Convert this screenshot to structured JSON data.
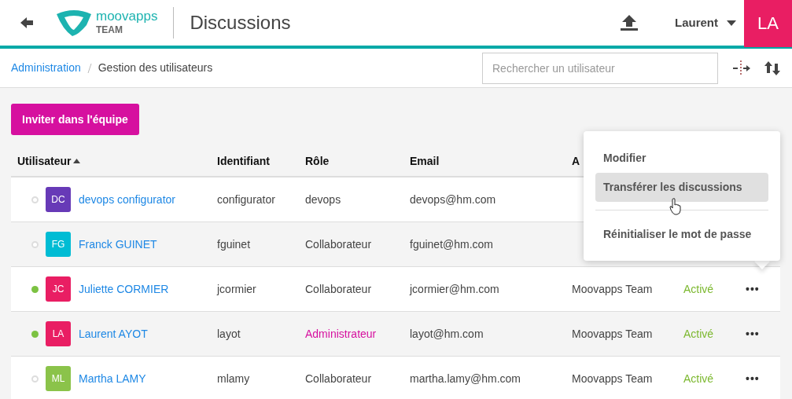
{
  "header": {
    "logo_name": "moovapps",
    "logo_sub": "TEAM",
    "title": "Discussions",
    "user": "Laurent",
    "avatar": "LA"
  },
  "breadcrumb": [
    {
      "label": "Administration",
      "selected": false
    },
    {
      "label": "Gestion des utilisateurs",
      "selected": true
    }
  ],
  "search": {
    "placeholder": "Rechercher un utilisateur"
  },
  "invite_button": "Inviter dans l'équipe",
  "table": {
    "columns": [
      {
        "label": "Utilisateur",
        "sorted": true
      },
      {
        "label": "Identifiant",
        "sorted": false
      },
      {
        "label": "Rôle",
        "sorted": false
      },
      {
        "label": "Email",
        "sorted": false
      },
      {
        "label": "A",
        "sorted": false
      }
    ],
    "rows": [
      {
        "online": false,
        "initials": "DC",
        "color": "#673ab7",
        "name": "devops configurator",
        "login": "configurator",
        "role": "devops",
        "admin": false,
        "email": "devops@hm.com"
      },
      {
        "online": false,
        "initials": "FG",
        "color": "#00bcd4",
        "name": "Franck GUINET",
        "login": "fguinet",
        "role": "Collaborateur",
        "admin": false,
        "email": "fguinet@hm.com"
      },
      {
        "online": true,
        "initials": "JC",
        "color": "#e91e63",
        "name": "Juliette CORMIER",
        "login": "jcormier",
        "role": "Collaborateur",
        "admin": false,
        "email": "jcormier@hm.com",
        "org": "Moovapps Team",
        "status": "Activé",
        "actions": "•••"
      },
      {
        "online": true,
        "initials": "LA",
        "color": "#e91e63",
        "name": "Laurent AYOT",
        "login": "layot",
        "role": "Administrateur",
        "admin": true,
        "email": "layot@hm.com",
        "org": "Moovapps Team",
        "status": "Activé",
        "actions": "•••"
      },
      {
        "online": false,
        "initials": "ML",
        "color": "#8bc34a",
        "name": "Martha LAMY",
        "login": "mlamy",
        "role": "Collaborateur",
        "admin": false,
        "email": "martha.lamy@hm.com",
        "org": "Moovapps Team",
        "status": "Activé",
        "actions": "•••"
      }
    ]
  },
  "menu": [
    {
      "label": "Modifier",
      "selected": false
    },
    {
      "label": "Transférer les discussions",
      "selected": true
    },
    {
      "label": "Réinitialiser le mot de passe",
      "selected": false
    }
  ]
}
